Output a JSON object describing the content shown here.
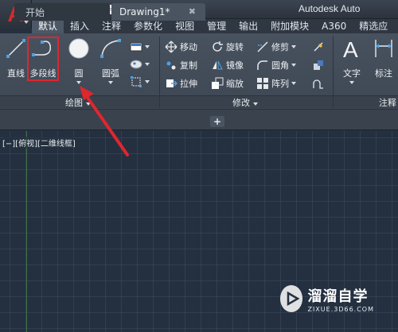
{
  "app": {
    "logo_letter": "A",
    "title": "Autodesk Auto"
  },
  "ribbon_tabs": [
    "默认",
    "插入",
    "注释",
    "参数化",
    "视图",
    "管理",
    "输出",
    "附加模块",
    "A360",
    "精选应"
  ],
  "ribbon_active_tab": 0,
  "draw_panel": {
    "title": "绘图",
    "line_label": "直线",
    "polyline_label": "多段线",
    "circle_label": "圆",
    "arc_label": "圆弧"
  },
  "modify_panel": {
    "title": "修改",
    "move": "移动",
    "rotate": "旋转",
    "trim": "修剪",
    "copy": "复制",
    "mirror": "镜像",
    "fillet": "圆角",
    "stretch": "拉伸",
    "scale": "缩放",
    "array": "阵列"
  },
  "annotation_panel": {
    "title": "注释",
    "text_label": "文字",
    "dim_label": "标注"
  },
  "doc_tabs": {
    "start": "开始",
    "drawing": "Drawing1*",
    "close": "✖",
    "add": "+"
  },
  "viewport_label": "[−][俯视][二维线框]",
  "watermark": {
    "title": "溜溜自学",
    "subtitle": "ZIXUE.3D66.COM"
  },
  "colors": {
    "accent_red": "#e0262e",
    "logo_red": "#d22b2b",
    "canvas_bg": "#243040"
  }
}
